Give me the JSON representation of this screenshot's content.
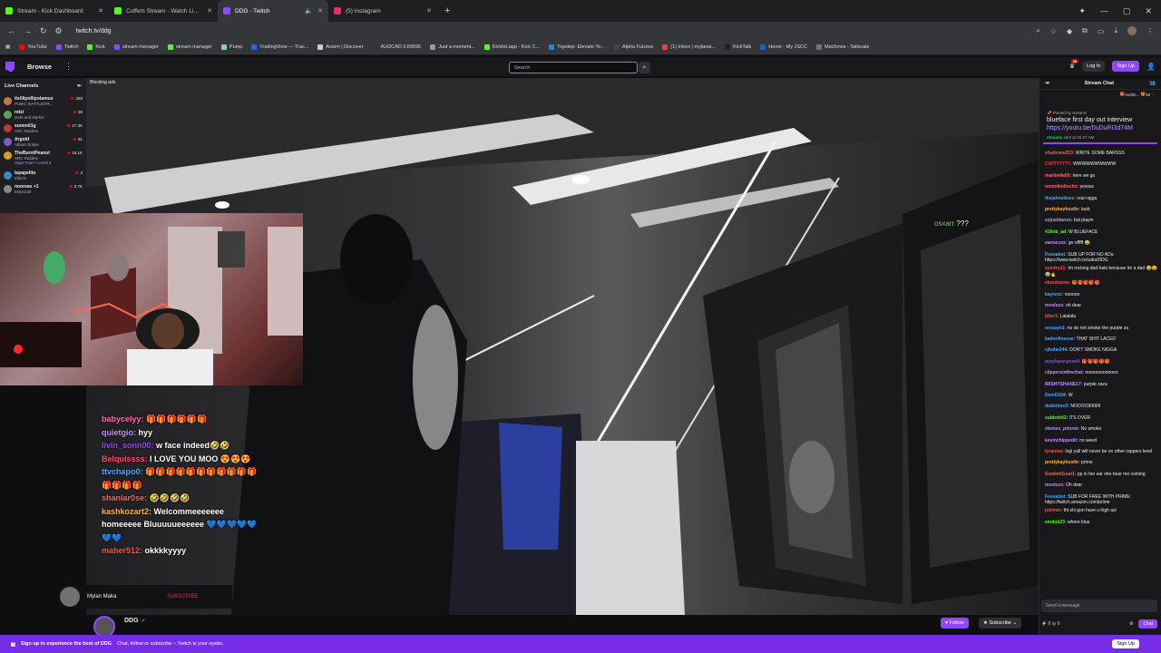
{
  "browser": {
    "tabs": [
      {
        "title": "Stream - Kick Dashboard",
        "color": "#53fc18",
        "icon": "kick-icon"
      },
      {
        "title": "Cuffem Stream - Watch Live on",
        "color": "#53fc18",
        "icon": "kick-icon"
      },
      {
        "title": "DDG - Twitch",
        "color": "#9147ff",
        "icon": "twitch-icon"
      },
      {
        "title": "(5) Instagram",
        "color": "#e1306c",
        "icon": "instagram-icon"
      }
    ],
    "url": "twitch.tv/ddg",
    "bookmarks": [
      {
        "label": "YouTube",
        "color": "#ff0000"
      },
      {
        "label": "Twitch",
        "color": "#9147ff"
      },
      {
        "label": "Kick",
        "color": "#53fc18"
      },
      {
        "label": "stream manager",
        "color": "#9147ff"
      },
      {
        "label": "stream manager",
        "color": "#53fc18"
      },
      {
        "label": "Pump",
        "color": "#8bd3a9"
      },
      {
        "label": "TradingView — Trac...",
        "color": "#2962ff"
      },
      {
        "label": "Axiom | Discover",
        "color": "#cccccc"
      },
      {
        "label": "AUDCAD 0.89596",
        "color": "#333333"
      },
      {
        "label": "Just a moment...",
        "color": "#999999"
      },
      {
        "label": "Kicklet.app - Kick C...",
        "color": "#53fc18"
      },
      {
        "label": "Topstep: Elevate Yo...",
        "color": "#1e88e5"
      },
      {
        "label": "Alpha Futures",
        "color": "#444444"
      },
      {
        "label": "(1) Inbox | mylanai...",
        "color": "#ea4335"
      },
      {
        "label": "KickTalk",
        "color": "#222222"
      },
      {
        "label": "Home - My JSCC",
        "color": "#1565c0"
      },
      {
        "label": "Machines - Tailscale",
        "color": "#777777"
      }
    ]
  },
  "twitch": {
    "browse": "Browse",
    "search_placeholder": "Search",
    "notif_count": "28",
    "login": "Log In",
    "signup": "Sign Up"
  },
  "sidebar": {
    "title": "Live Channels",
    "channels": [
      {
        "name": "itsillipollipotamus",
        "game": "PUBG: BATTLEGR...",
        "viewers": "293",
        "color": "#c47a3a"
      },
      {
        "name": "retzi",
        "game": "Dark and Darker",
        "viewers": "38",
        "color": "#5fa05f"
      },
      {
        "name": "summit1g",
        "game": "ARC Raiders",
        "viewers": "17.3K",
        "color": "#c0392b"
      },
      {
        "name": "Argold",
        "game": "Albion Online",
        "viewers": "61",
        "color": "#7a5fc0"
      },
      {
        "name": "TheBurntPeanut",
        "game": "ARC Raiders",
        "viewers": "15.1K",
        "color": "#d4a017"
      },
      {
        "name": "lepapelito",
        "game": "IdleOn",
        "viewers": "3",
        "color": "#3a88c4"
      },
      {
        "name": "nooreax +1",
        "game": "Minecraft",
        "viewers": "2.7K",
        "color": "#888888"
      }
    ],
    "hype_train": "Hype Train • Level 4"
  },
  "video": {
    "blocking": "Blocking ads",
    "chat_overlay_user": "osxarr",
    "chat_overlay_text": "???",
    "overlay_chat": [
      {
        "user": "babycelyy:",
        "text": "🎁🎁🎁🎁🎁🎁",
        "color": "#ff69b4"
      },
      {
        "user": "quietgio:",
        "text": "hyy",
        "color": "#bf94ff"
      },
      {
        "user": "livin_sonn00:",
        "text": "w face indeed🤣🤣",
        "color": "#9147ff"
      },
      {
        "user": "Belquissss:",
        "text": "I LOVE YOU MOO 😍😍😍",
        "color": "#ff4f6e"
      },
      {
        "user": "ttvchapo0:",
        "text": "🎁🎁🎁🎁🎁🎁🎁🎁🎁🎁🎁🎁🎁🎁🎁",
        "color": "#4aa8ff"
      },
      {
        "user": "shaniar0se:",
        "text": "🤣🤣🤣🤣",
        "color": "#ff6347"
      },
      {
        "user": "kashkozart2:",
        "text": "Welcommeeeeeee homeeeee Bluuuuueeeeee 💙💙💙💙💙💙💙",
        "color": "#ffb347"
      },
      {
        "user": "maher512:",
        "text": "okkkkyyyy",
        "color": "#ff4f4f"
      }
    ],
    "promo_name": "Mylan Maka",
    "promo_sub": "SUBSCRIBE",
    "streamer": "DDG",
    "follow": "Follow",
    "subscribe": "Subscribe"
  },
  "banner": {
    "bold": "Sign up to experience the best of DDG",
    "text": "Chat, follow or subscribe – Twitch is your oyster.",
    "button": "Sign Up"
  },
  "chat": {
    "title": "Stream Chat",
    "gift_user": "nuthle...",
    "gift_count": "60",
    "pinned_label": "Pinned by streams",
    "pinned_text": "blueface first day out interview",
    "pinned_link": "https://youtu.be/0uDuRI3d74M",
    "pinned_by": "streams",
    "pinned_time": "sent at 01:27 AM",
    "messages": [
      {
        "user": "shadoww253:",
        "text": "WRITE SOME BARSSS",
        "color": "#ff4f4f"
      },
      {
        "user": "CWITTTTTY:",
        "text": "WWWWWWWWWW",
        "color": "#ff2d2d"
      },
      {
        "user": "maribella00:",
        "text": "here we go",
        "color": "#ff6b6b"
      },
      {
        "user": "nomolimitscho:",
        "text": "yessss",
        "color": "#ff6b6b"
      },
      {
        "user": "thejahneltoes:",
        "text": "real nigga",
        "color": "#4aa8ff"
      },
      {
        "user": "prettykayhustle:",
        "text": "laub",
        "color": "#ffb347"
      },
      {
        "user": "xxjustdanxx:",
        "text": "but playin",
        "color": "#c58fff"
      },
      {
        "user": "419ob_ad:",
        "text": "W BLUEFACE",
        "color": "#53fc18"
      },
      {
        "user": "vannexxx:",
        "text": "go offfff 😂",
        "color": "#c58fff"
      },
      {
        "user": "Fossabot:",
        "text": "SUB UP FOR NO ADs: https://www.twitch.tv/subs/DDG",
        "color": "#4aa8ff"
      },
      {
        "user": "syedey11:",
        "text": "Im rocking dad hats because Im a dad 😂😂😂🔥",
        "color": "#ff4f4f"
      },
      {
        "user": "eboutoeme:",
        "text": "🎁🎁🎁🎁🎁",
        "color": "#ff4f4f"
      },
      {
        "user": "kayrexx:",
        "text": "nooooo",
        "color": "#4aa8ff"
      },
      {
        "user": "moxluzx:",
        "text": "oh dear",
        "color": "#c58fff"
      },
      {
        "user": "jitter1:",
        "text": "Lalalala",
        "color": "#ff4f4f"
      },
      {
        "user": "ressayo1:",
        "text": "no do not smoke the purple za",
        "color": "#4aa8ff"
      },
      {
        "user": "kadenfinesse:",
        "text": "THAT SHIT LACED",
        "color": "#4aa8ff"
      },
      {
        "user": "cjkobe244:",
        "text": "DON'T SMOKE NIGGA",
        "color": "#4aa8ff"
      },
      {
        "user": "purplepurpose4:",
        "text": "🎁🎁🎁🎁🎁",
        "color": "#9147ff"
      },
      {
        "user": "clippersinthechat:",
        "text": "noooooooooooo",
        "color": "#c58fff"
      },
      {
        "user": "IRISHYSHANE17:",
        "text": "purple zaza",
        "color": "#c58fff"
      },
      {
        "user": "DemD104:",
        "text": "W",
        "color": "#4aa8ff"
      },
      {
        "user": "dudetimo3:",
        "text": "NOOOOIIIIIIIIII",
        "color": "#4aa8ff"
      },
      {
        "user": "subbob42:",
        "text": "ITS OVER",
        "color": "#53fc18"
      },
      {
        "user": "xlomsx_prinnie:",
        "text": "No smoke",
        "color": "#c58fff"
      },
      {
        "user": "kevinchippedit:",
        "text": "no weed",
        "color": "#c58fff"
      },
      {
        "user": "tyraniea:",
        "text": "Ingl yall will never be on other rappers level",
        "color": "#ff4f4f"
      },
      {
        "user": "prettykayhustle:",
        "text": "prime",
        "color": "#ffb347"
      },
      {
        "user": "GoatletiGoat1:",
        "text": "pp in her ear she hear me coming",
        "color": "#ff6347"
      },
      {
        "user": "moxluzx:",
        "text": "Oh dear",
        "color": "#c58fff"
      },
      {
        "user": "Fossabot:",
        "text": "SUB FOR FREE WITH PRIME: https://twitch.amazon.com/prime",
        "color": "#4aa8ff"
      },
      {
        "user": "jsdimm:",
        "text": "tht shi gon have u high asl",
        "color": "#ff4f4f"
      },
      {
        "user": "emdub23:",
        "text": "where blue",
        "color": "#53fc18"
      }
    ],
    "input_placeholder": "Send a message",
    "points": "0",
    "bits": "0",
    "chat_button": "Chat"
  }
}
